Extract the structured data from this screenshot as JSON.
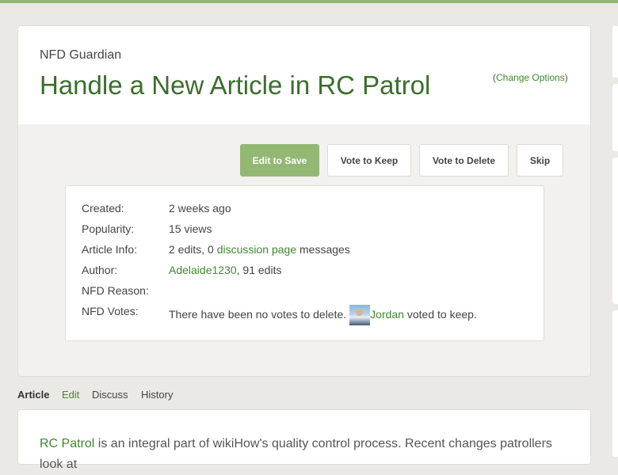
{
  "header": {
    "tool_name": "NFD Guardian",
    "title": "Handle a New Article in RC Patrol",
    "change_options": {
      "open": "(",
      "label": "Change Options",
      "close": ")"
    }
  },
  "actions": {
    "edit_to_save": "Edit to Save",
    "vote_to_keep": "Vote to Keep",
    "vote_to_delete": "Vote to Delete",
    "skip": "Skip"
  },
  "info": {
    "created_label": "Created:",
    "created_value": "2 weeks ago",
    "popularity_label": "Popularity:",
    "popularity_value": "15 views",
    "article_info_label": "Article Info:",
    "edits_text": "2 edits, 0 ",
    "discussion_link": "discussion page",
    "messages_text": " messages",
    "author_label": "Author:",
    "author_name": "Adelaide1230",
    "author_edits": ", 91 edits",
    "nfd_reason_label": "NFD Reason:",
    "nfd_votes_label": "NFD Votes:",
    "votes_text": "There have been no votes to delete.",
    "voter_name": "Jordan",
    "voted_text": " voted to keep."
  },
  "tabs": [
    {
      "label": "Article",
      "active": true
    },
    {
      "label": "Edit",
      "active": false
    },
    {
      "label": "Discuss",
      "active": false
    },
    {
      "label": "History",
      "active": false
    }
  ],
  "article": {
    "link_text": "RC Patrol",
    "body": " is an integral part of wikiHow's quality control process. Recent changes patrollers look at"
  },
  "colors": {
    "accent_green": "#93b874",
    "link_green": "#3f8a2c",
    "title_green": "#3c6e2e",
    "background": "#ebe9e6"
  }
}
